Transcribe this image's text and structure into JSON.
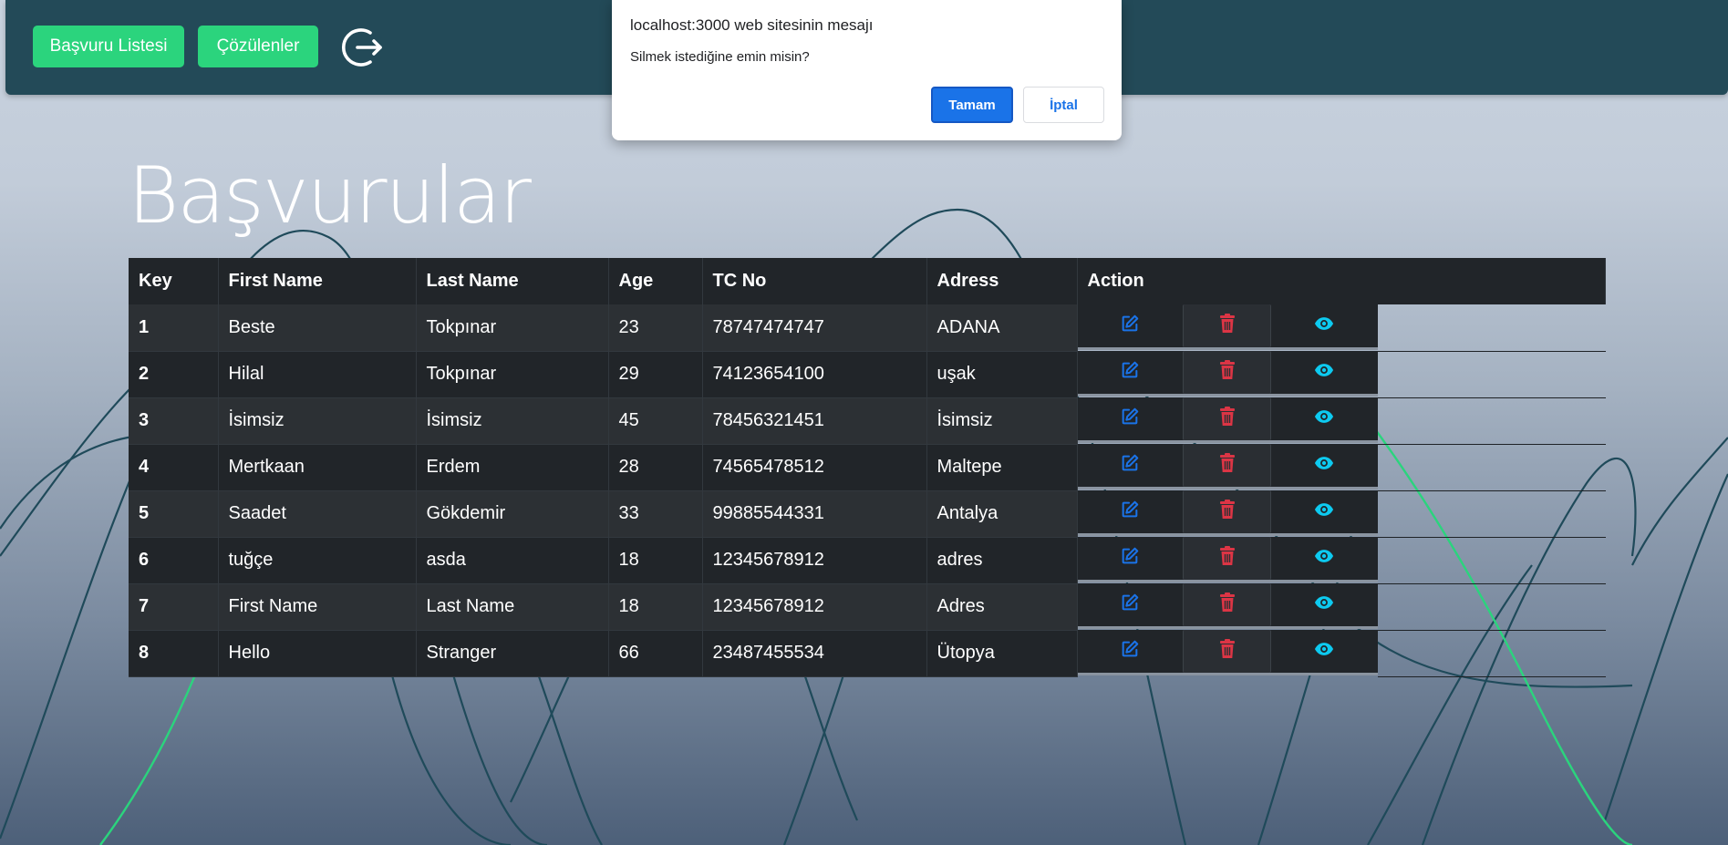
{
  "colors": {
    "navbar": "#234a58",
    "nav_button": "#2bd47d",
    "edit_icon": "#1a73e8",
    "delete_icon": "#dc3545",
    "view_icon": "#0dcaf0",
    "dialog_ok": "#1a73e8"
  },
  "navbar": {
    "applications_list_label": "Başvuru Listesi",
    "solved_label": "Çözülenler",
    "logout_icon": "logout-icon"
  },
  "page": {
    "title": "Başvurular"
  },
  "table": {
    "columns": [
      "Key",
      "First Name",
      "Last Name",
      "Age",
      "TC No",
      "Adress",
      "Action"
    ],
    "rows": [
      {
        "key": "1",
        "first_name": "Beste",
        "last_name": "Tokpınar",
        "age": "23",
        "tc_no": "78747474747",
        "adress": "ADANA"
      },
      {
        "key": "2",
        "first_name": "Hilal",
        "last_name": "Tokpınar",
        "age": "29",
        "tc_no": "74123654100",
        "adress": "uşak"
      },
      {
        "key": "3",
        "first_name": "İsimsiz",
        "last_name": "İsimsiz",
        "age": "45",
        "tc_no": "78456321451",
        "adress": "İsimsiz"
      },
      {
        "key": "4",
        "first_name": "Mertkaan",
        "last_name": "Erdem",
        "age": "28",
        "tc_no": "74565478512",
        "adress": "Maltepe"
      },
      {
        "key": "5",
        "first_name": "Saadet",
        "last_name": "Gökdemir",
        "age": "33",
        "tc_no": "99885544331",
        "adress": "Antalya"
      },
      {
        "key": "6",
        "first_name": "tuğçe",
        "last_name": "asda",
        "age": "18",
        "tc_no": "12345678912",
        "adress": "adres"
      },
      {
        "key": "7",
        "first_name": "First Name",
        "last_name": "Last Name",
        "age": "18",
        "tc_no": "12345678912",
        "adress": "Adres"
      },
      {
        "key": "8",
        "first_name": "Hello",
        "last_name": "Stranger",
        "age": "66",
        "tc_no": "23487455534",
        "adress": "Ütopya"
      }
    ],
    "action_icons": [
      "edit-icon",
      "trash-icon",
      "eye-icon"
    ]
  },
  "dialog": {
    "title": "localhost:3000 web sitesinin mesajı",
    "message": "Silmek istediğine emin misin?",
    "ok_label": "Tamam",
    "cancel_label": "İptal"
  }
}
